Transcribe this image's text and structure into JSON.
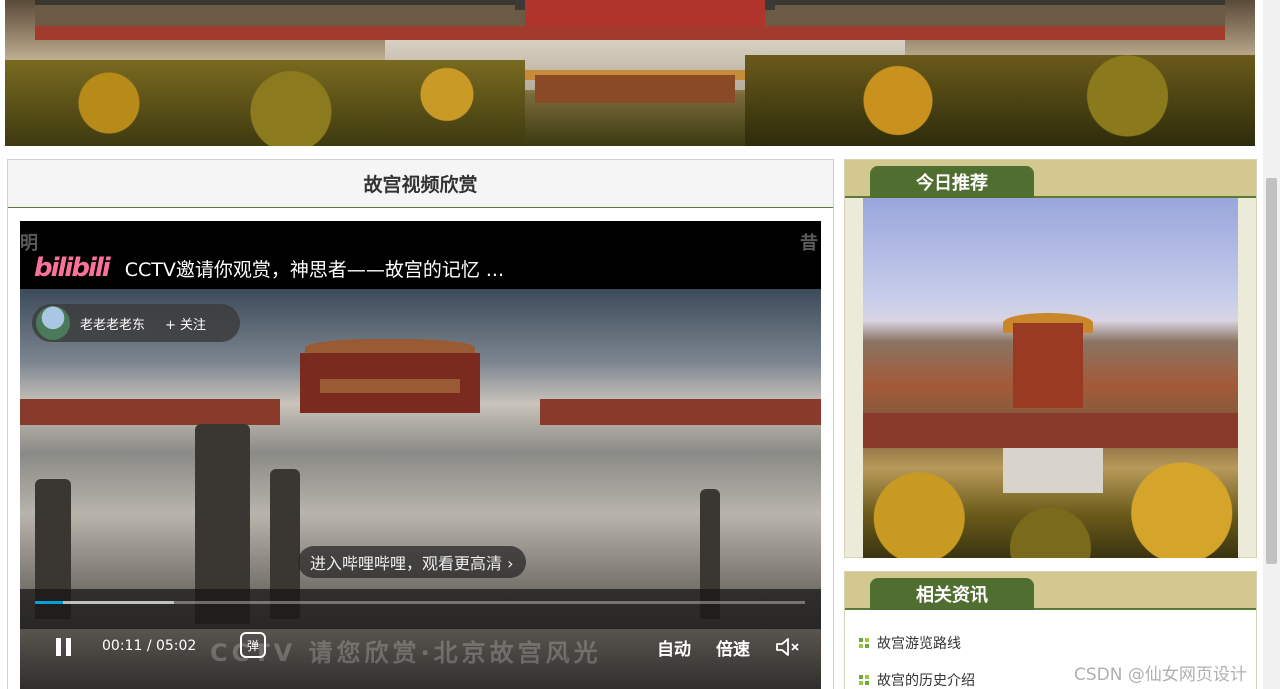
{
  "video_section": {
    "heading": "故宫视频欣赏",
    "player": {
      "logo": "bilibili",
      "title": "CCTV邀请你观赏，神思者——故宫的记忆 ...",
      "uploader": "老老老老东",
      "follow_label": "+ 关注",
      "cta": "进入哔哩哔哩，观看更高清 ›",
      "current_time": "00:11",
      "duration": "05:02",
      "time_separator": "/",
      "danmaku_label": "弹",
      "quality_label": "自动",
      "speed_label": "倍速",
      "watermark": "CCTV 请您欣赏·北京故宫风光",
      "corner_left": "明",
      "corner_right": "昔",
      "progress_played": 0.036,
      "progress_buffered": 0.18
    }
  },
  "today_recommend": {
    "tab_label": "今日推荐"
  },
  "related_news": {
    "tab_label": "相关资讯",
    "items": [
      "故宫游览路线",
      "故宫的历史介绍"
    ]
  },
  "watermark_text": "CSDN @仙女网页设计",
  "colors": {
    "green_tab": "#4f6e2f",
    "tab_bar": "#d4c891",
    "bilibili_pink": "#fb7299",
    "progress_blue": "#00a1d6"
  }
}
